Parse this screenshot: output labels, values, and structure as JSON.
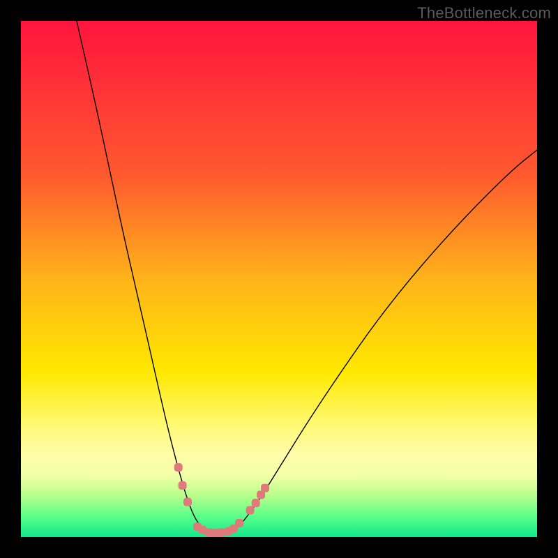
{
  "watermark": "TheBottleneck.com",
  "chart_data": {
    "type": "line",
    "title": "",
    "xlabel": "",
    "ylabel": "",
    "xlim": [
      0,
      100
    ],
    "ylim": [
      0,
      100
    ],
    "grid": false,
    "legend": false,
    "background_gradient_stops": [
      {
        "offset": 0,
        "color": "#ff143e"
      },
      {
        "offset": 0.3,
        "color": "#ff5a2e"
      },
      {
        "offset": 0.5,
        "color": "#ffb31a"
      },
      {
        "offset": 0.68,
        "color": "#ffe800"
      },
      {
        "offset": 0.78,
        "color": "#fff970"
      },
      {
        "offset": 0.84,
        "color": "#fffca8"
      },
      {
        "offset": 0.88,
        "color": "#f4ffa8"
      },
      {
        "offset": 0.92,
        "color": "#b6ff8a"
      },
      {
        "offset": 0.96,
        "color": "#5aff8a"
      },
      {
        "offset": 1.0,
        "color": "#11e88a"
      }
    ],
    "series": [
      {
        "name": "left-arm",
        "color": "#000000",
        "width": 1.4,
        "points": [
          {
            "x": 10.8,
            "y": 100
          },
          {
            "x": 14.0,
            "y": 86
          },
          {
            "x": 17.0,
            "y": 72
          },
          {
            "x": 20.0,
            "y": 58
          },
          {
            "x": 23.0,
            "y": 45
          },
          {
            "x": 25.5,
            "y": 34
          },
          {
            "x": 28.0,
            "y": 23
          },
          {
            "x": 30.0,
            "y": 15
          },
          {
            "x": 32.0,
            "y": 8
          },
          {
            "x": 33.5,
            "y": 4
          },
          {
            "x": 35.0,
            "y": 1.8
          },
          {
            "x": 36.5,
            "y": 0.6
          },
          {
            "x": 38.0,
            "y": 0.3
          }
        ]
      },
      {
        "name": "right-arm",
        "color": "#000000",
        "width": 1.4,
        "points": [
          {
            "x": 38.0,
            "y": 0.3
          },
          {
            "x": 40.0,
            "y": 0.6
          },
          {
            "x": 42.0,
            "y": 1.8
          },
          {
            "x": 44.0,
            "y": 4.2
          },
          {
            "x": 47.0,
            "y": 8.5
          },
          {
            "x": 51.0,
            "y": 15
          },
          {
            "x": 56.0,
            "y": 23
          },
          {
            "x": 62.0,
            "y": 32
          },
          {
            "x": 69.0,
            "y": 42
          },
          {
            "x": 77.0,
            "y": 52
          },
          {
            "x": 86.0,
            "y": 62
          },
          {
            "x": 95.0,
            "y": 71
          },
          {
            "x": 100.0,
            "y": 75
          }
        ]
      },
      {
        "name": "valley-markers",
        "color": "#de7b7a",
        "type": "scatter",
        "marker_size": 12,
        "points": [
          {
            "x": 30.5,
            "y": 13.5
          },
          {
            "x": 31.3,
            "y": 10.0
          },
          {
            "x": 32.3,
            "y": 6.8
          },
          {
            "x": 34.2,
            "y": 2.0
          },
          {
            "x": 35.2,
            "y": 1.4
          },
          {
            "x": 36.4,
            "y": 0.9
          },
          {
            "x": 37.6,
            "y": 0.8
          },
          {
            "x": 38.8,
            "y": 0.9
          },
          {
            "x": 40.2,
            "y": 1.1
          },
          {
            "x": 41.2,
            "y": 1.6
          },
          {
            "x": 42.3,
            "y": 2.7
          },
          {
            "x": 44.4,
            "y": 5.2
          },
          {
            "x": 45.5,
            "y": 6.6
          },
          {
            "x": 46.5,
            "y": 8.2
          },
          {
            "x": 47.3,
            "y": 9.5
          }
        ]
      }
    ]
  }
}
